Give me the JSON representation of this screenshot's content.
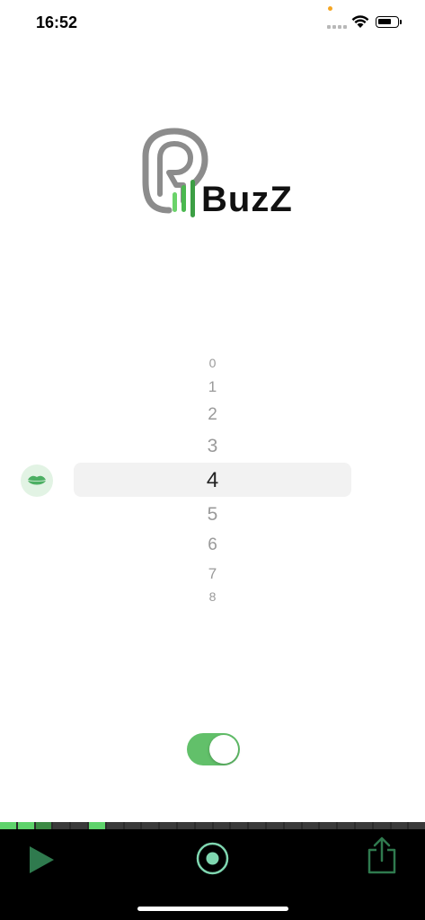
{
  "status_bar": {
    "time": "16:52"
  },
  "app": {
    "logo_text": "BuzZ"
  },
  "picker": {
    "items": [
      "0",
      "1",
      "2",
      "3",
      "4",
      "5",
      "6",
      "7",
      "8"
    ],
    "selected_index": 4,
    "selected_value": "4"
  },
  "toggle": {
    "on": true
  },
  "level_meter": {
    "segment_count": 24,
    "active_segments": [
      0,
      1,
      2,
      5
    ]
  },
  "toolbar": {
    "play": "play-icon",
    "record": "record-icon",
    "share": "share-icon"
  },
  "colors": {
    "accent_green": "#62c06a",
    "toolbar_green": "#2f7a4e",
    "record_teal": "#7fd6b0"
  }
}
